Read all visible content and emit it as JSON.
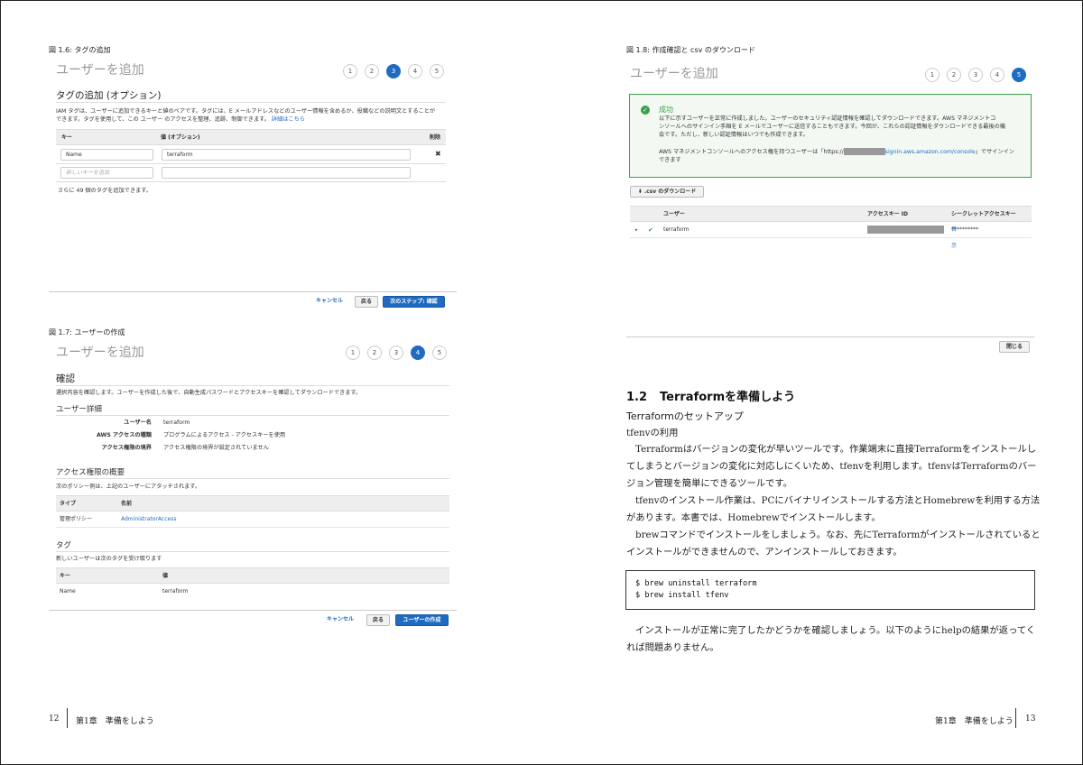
{
  "left": {
    "fig6": {
      "caption": "図 1.6: タグの追加",
      "wizard_title": "ユーザーを追加",
      "steps": [
        "1",
        "2",
        "3",
        "4",
        "5"
      ],
      "section_title": "タグの追加 (オプション)",
      "description_1": "IAM タグは、ユーザーに追加できるキーと値のペアです。タグには、E メールアドレスなどのユーザー情報を含めるか、役職などの説明文とすることが",
      "description_2": "できます。タグを使用して、この ユーザー のアクセスを整理、追跡、制御できます。",
      "learn_more": "詳細はこちら",
      "col_key": "キー",
      "col_value": "値 (オプション)",
      "col_delete": "削除",
      "row_key": "Name",
      "row_value": "terraform",
      "delete_glyph": "✖",
      "new_key_placeholder": "新しいキーを追加",
      "remaining": "さらに 49 個のタグを追加できます。",
      "cancel": "キャンセル",
      "back": "戻る",
      "next": "次のステップ: 確認"
    },
    "fig7": {
      "caption": "図 1.7: ユーザーの作成",
      "wizard_title": "ユーザーを追加",
      "steps": [
        "1",
        "2",
        "3",
        "4",
        "5"
      ],
      "section_title": "確認",
      "description": "選択内容を確認します。ユーザーを作成した後で、自動生成パスワードとアクセスキーを確認してダウンロードできます。",
      "details_title": "ユーザー詳細",
      "details": [
        {
          "label": "ユーザー名",
          "value": "terraform"
        },
        {
          "label": "AWS アクセスの種類",
          "value": "プログラムによるアクセス - アクセスキーを使用"
        },
        {
          "label": "アクセス権限の境界",
          "value": "アクセス権限の境界が設定されていません"
        }
      ],
      "perm_title": "アクセス権限の概要",
      "perm_desc": "次のポリシー例は、上記のユーザーにアタッチされます。",
      "perm_col_type": "タイプ",
      "perm_col_name": "名前",
      "perm_type": "管理ポリシー",
      "perm_name": "AdministratorAccess",
      "tag_title": "タグ",
      "tag_desc": "新しいユーザーは次のタグを受け取ります",
      "tag_col_key": "キー",
      "tag_col_value": "値",
      "tag_key": "Name",
      "tag_value": "terraform",
      "cancel": "キャンセル",
      "back": "戻る",
      "create": "ユーザーの作成"
    },
    "footer_page": "12",
    "footer_chapter": "第1章　準備をしよう"
  },
  "right": {
    "fig8": {
      "caption": "図 1.8: 作成確認と csv のダウンロード",
      "wizard_title": "ユーザーを追加",
      "steps": [
        "1",
        "2",
        "3",
        "4",
        "5"
      ],
      "success_title": "成功",
      "success_1": "以下に示すユーザーを正常に作成しました。ユーザーのセキュリティ認証情報を確認してダウンロードできます。AWS マネジメントコ",
      "success_2": "ンソールへのサインイン手順を E メールでユーザーに送信することもできます。今回が、これらの認証情報をダウンロードできる最後の機",
      "success_3": "会です。ただし、新しい認証情報はいつでも作成できます。",
      "signin_prefix": "AWS マネジメントコンソールへのアクセス権を持つユーザーは「https://",
      "signin_url": "signin.aws.amazon.com/console",
      "signin_suffix": "」でサインイン",
      "signin_2": "できます",
      "download": ".csv のダウンロード",
      "col_user": "ユーザー",
      "col_key_id": "アクセスキー ID",
      "col_secret": "シークレットアクセスキー",
      "row_user": "terraform",
      "row_secret_mask": "**********",
      "row_show": "表示",
      "close": "閉じる"
    },
    "section_number": "1.2",
    "section_title": "Terraformを準備しよう",
    "subsection": "Terraformのセットアップ",
    "subsubsection": "tfenvの利用",
    "para1_l1": "Terraformはバージョンの変化が早いツールです。作業端末に直接Terraformをインストールし",
    "para1_l2": "てしまうとバージョンの変化に対応しにくいため、tfenvを利用します。tfenvはTerraformのバー",
    "para1_l3": "ジョン管理を簡単にできるツールです。",
    "para2_l1": "tfenvのインストール作業は、PCにバイナリインストールする方法とHomebrewを利用する方法",
    "para2_l2": "があります。本書では、Homebrewでインストールします。",
    "para3_l1": "brewコマンドでインストールをしましょう。なお、先にTerraformがインストールされていると",
    "para3_l2": "インストールができませんので、アンインストールしておきます。",
    "code_l1": "$ brew uninstall terraform",
    "code_l2": "$ brew install tfenv",
    "para4_l1": "インストールが正常に完了したかどうかを確認しましょう。以下のようにhelpの結果が返ってく",
    "para4_l2": "れば問題ありません。",
    "footer_chapter": "第1章　準備をしよう",
    "footer_page": "13"
  }
}
